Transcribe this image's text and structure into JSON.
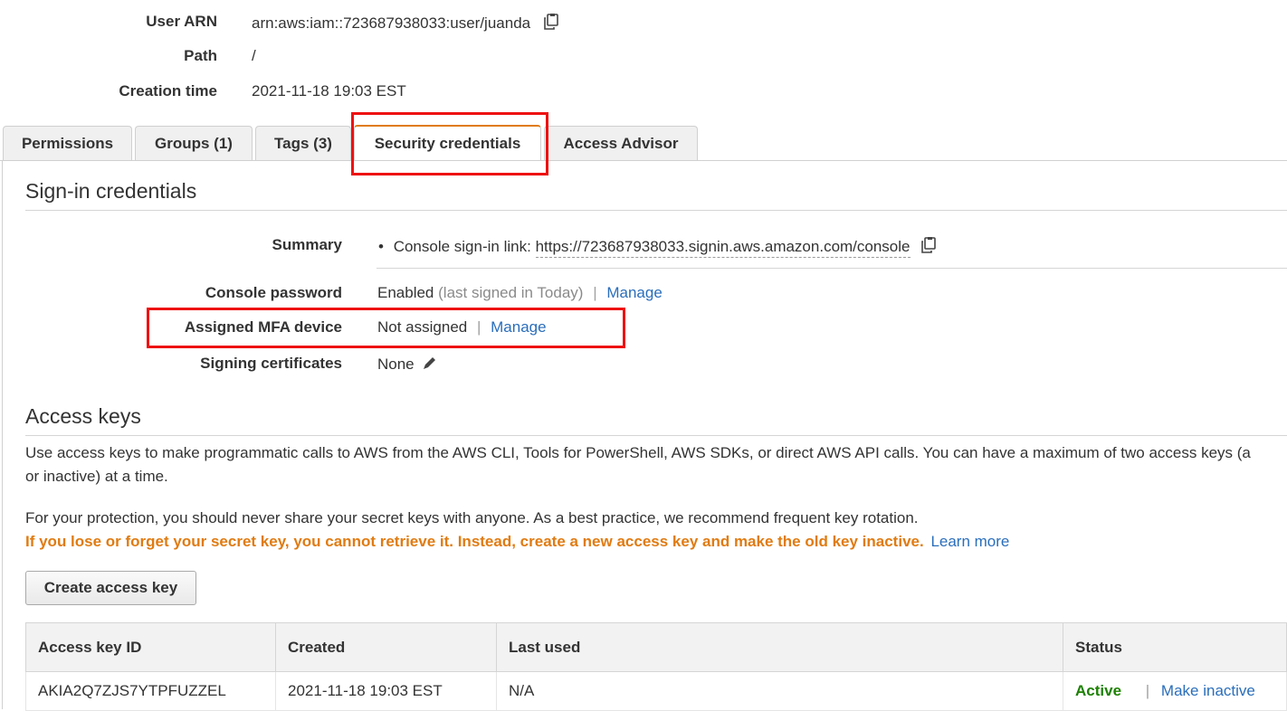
{
  "summary_top": {
    "user_arn_label": "User ARN",
    "user_arn_value": "arn:aws:iam::723687938033:user/juanda",
    "path_label": "Path",
    "path_value": "/",
    "creation_time_label": "Creation time",
    "creation_time_value": "2021-11-18 19:03 EST"
  },
  "tabs": [
    {
      "label": "Permissions"
    },
    {
      "label": "Groups (1)"
    },
    {
      "label": "Tags (3)"
    },
    {
      "label": "Security credentials"
    },
    {
      "label": "Access Advisor"
    }
  ],
  "active_tab": "Security credentials",
  "signin": {
    "title": "Sign-in credentials",
    "summary_label": "Summary",
    "console_link_prefix": "Console sign-in link:",
    "console_link_url": "https://723687938033.signin.aws.amazon.com/console",
    "console_password_label": "Console password",
    "console_password_status": "Enabled",
    "console_password_note": "(last signed in Today)",
    "manage_label": "Manage",
    "mfa_label": "Assigned MFA device",
    "mfa_value": "Not assigned",
    "signing_certs_label": "Signing certificates",
    "signing_certs_value": "None",
    "separator": "|"
  },
  "access_keys": {
    "title": "Access keys",
    "desc_line1": "Use access keys to make programmatic calls to AWS from the AWS CLI, Tools for PowerShell, AWS SDKs, or direct AWS API calls. You can have a maximum of two access keys (a",
    "desc_line2": "or inactive) at a time.",
    "protection_text": "For your protection, you should never share your secret keys with anyone. As a best practice, we recommend frequent key rotation.",
    "warning_text": "If you lose or forget your secret key, you cannot retrieve it. Instead, create a new access key and make the old key inactive.",
    "learn_more": "Learn more",
    "create_button": "Create access key",
    "columns": [
      "Access key ID",
      "Created",
      "Last used",
      "Status"
    ],
    "rows": [
      {
        "id": "AKIA2Q7ZJS7YTPFUZZEL",
        "created": "2021-11-18 19:03 EST",
        "last_used": "N/A",
        "status": "Active",
        "action": "Make inactive"
      }
    ]
  },
  "colors": {
    "link": "#2a6ebb",
    "highlight": "#ee1111",
    "active_tab_accent": "#e07b12",
    "warning": "#e07b12",
    "active_status": "#1d8102"
  },
  "icons": [
    "copy-icon",
    "pencil-icon"
  ]
}
